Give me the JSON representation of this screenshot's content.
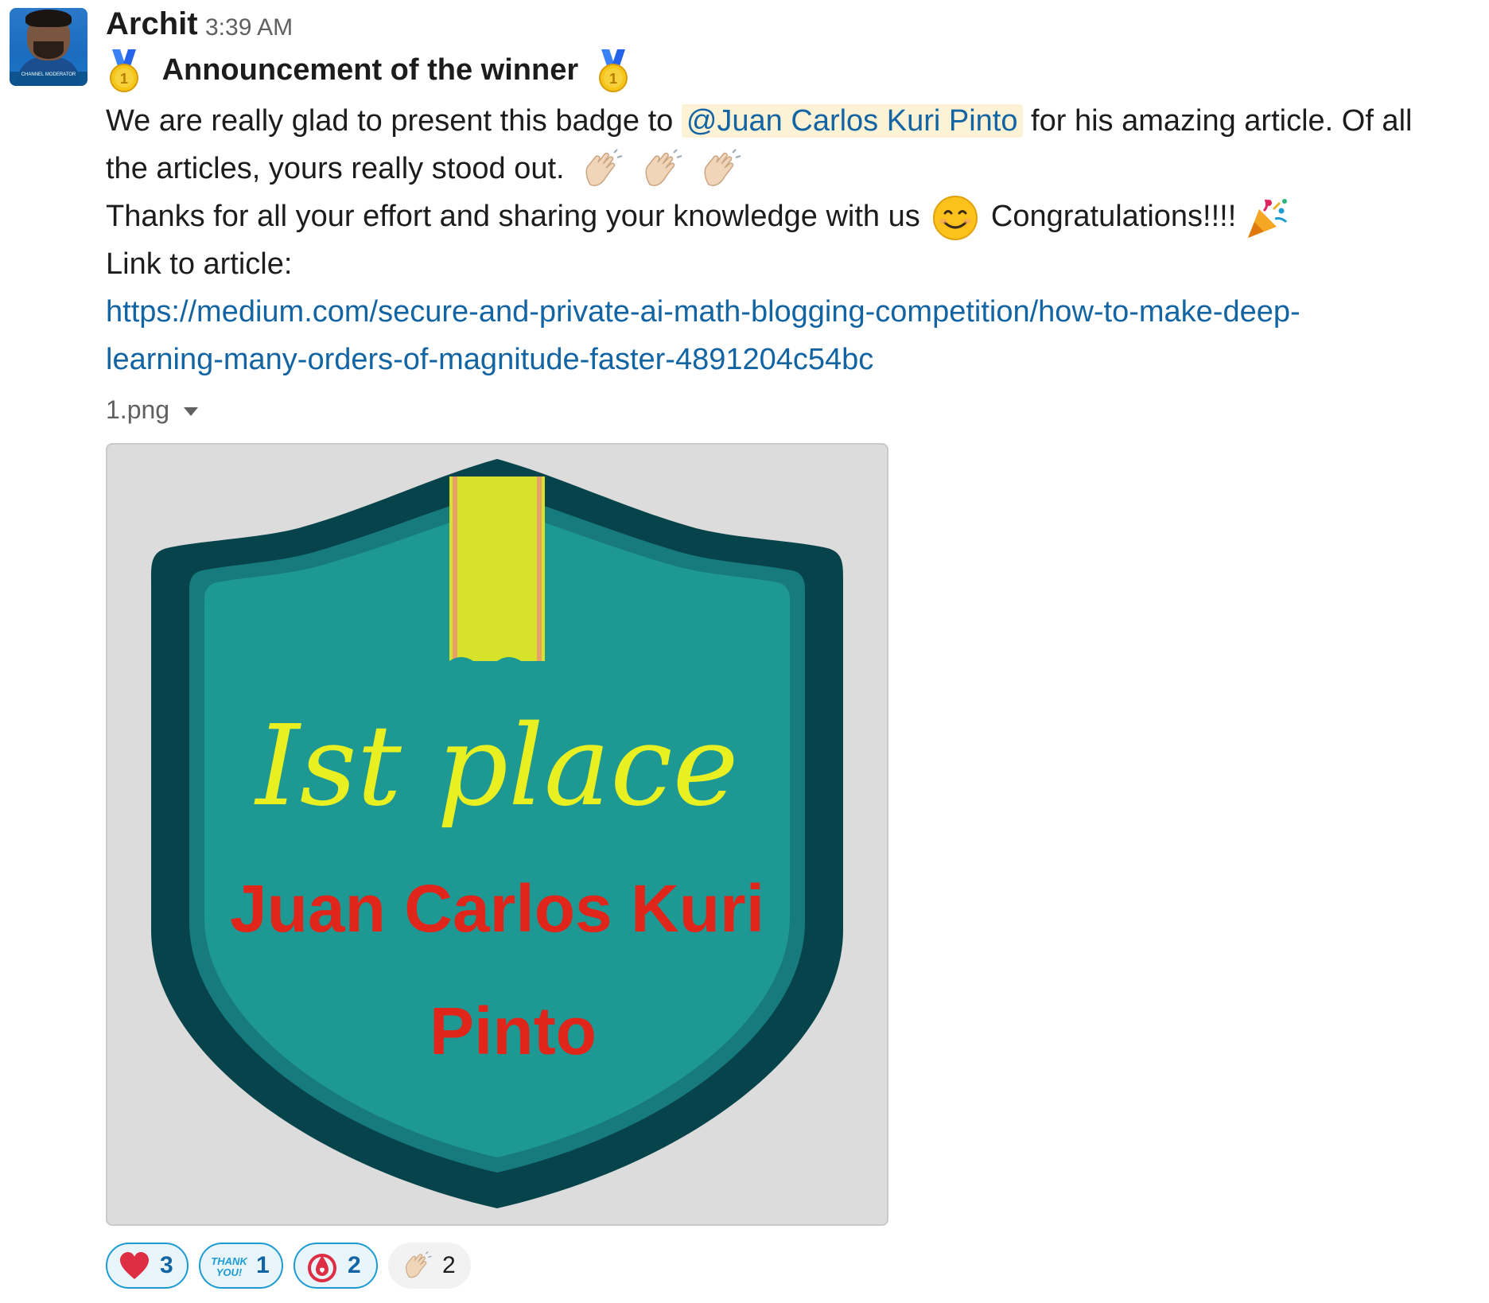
{
  "message": {
    "sender": "Archit",
    "timestamp": "3:39 AM",
    "avatar_badge_text": "CHANNEL MODERATOR",
    "title": "Announcement of the winner",
    "para1_part1": "We are really glad to present this badge to ",
    "mention": "@Juan Carlos Kuri Pinto",
    "para1_part2": "  for his amazing article. Of all",
    "para2": "the articles, yours really stood out.",
    "para3_part1": "Thanks for all your effort and sharing your knowledge with us",
    "para3_part2": "Congratulations!!!!",
    "para4": "Link to article:",
    "link_line1": "https://medium.com/secure-and-private-ai-math-blogging-competition/how-to-make-deep-",
    "link_line2": "learning-many-orders-of-magnitude-faster-4891204c54bc"
  },
  "attachment": {
    "filename": "1.png",
    "badge_place_text": "Ist place",
    "badge_name_line1": "Juan Carlos Kuri",
    "badge_name_line2": "Pinto",
    "colors": {
      "background": "#dcdcdc",
      "shield_outer": "#07434a",
      "shield_mid": "#177a7d",
      "shield_inner": "#1e9893",
      "ribbon": "#d6e32a",
      "place_text": "#e8f022",
      "name_text": "#e0251b"
    }
  },
  "reactions": [
    {
      "icon": "heart-icon",
      "count": "3"
    },
    {
      "icon": "thank-you-icon",
      "icon_text": "THANK YOU!",
      "count": "1"
    },
    {
      "icon": "blood-drop-icon",
      "count": "2"
    },
    {
      "icon": "clapping-hands-icon",
      "count": "2"
    }
  ],
  "emoji_icons": {
    "title_left": "gold-medal-icon",
    "title_right": "gold-medal-icon",
    "waves": [
      "waving-hand-icon",
      "waving-hand-icon",
      "waving-hand-icon"
    ],
    "smile": "smiling-face-icon",
    "party": "party-popper-icon"
  }
}
